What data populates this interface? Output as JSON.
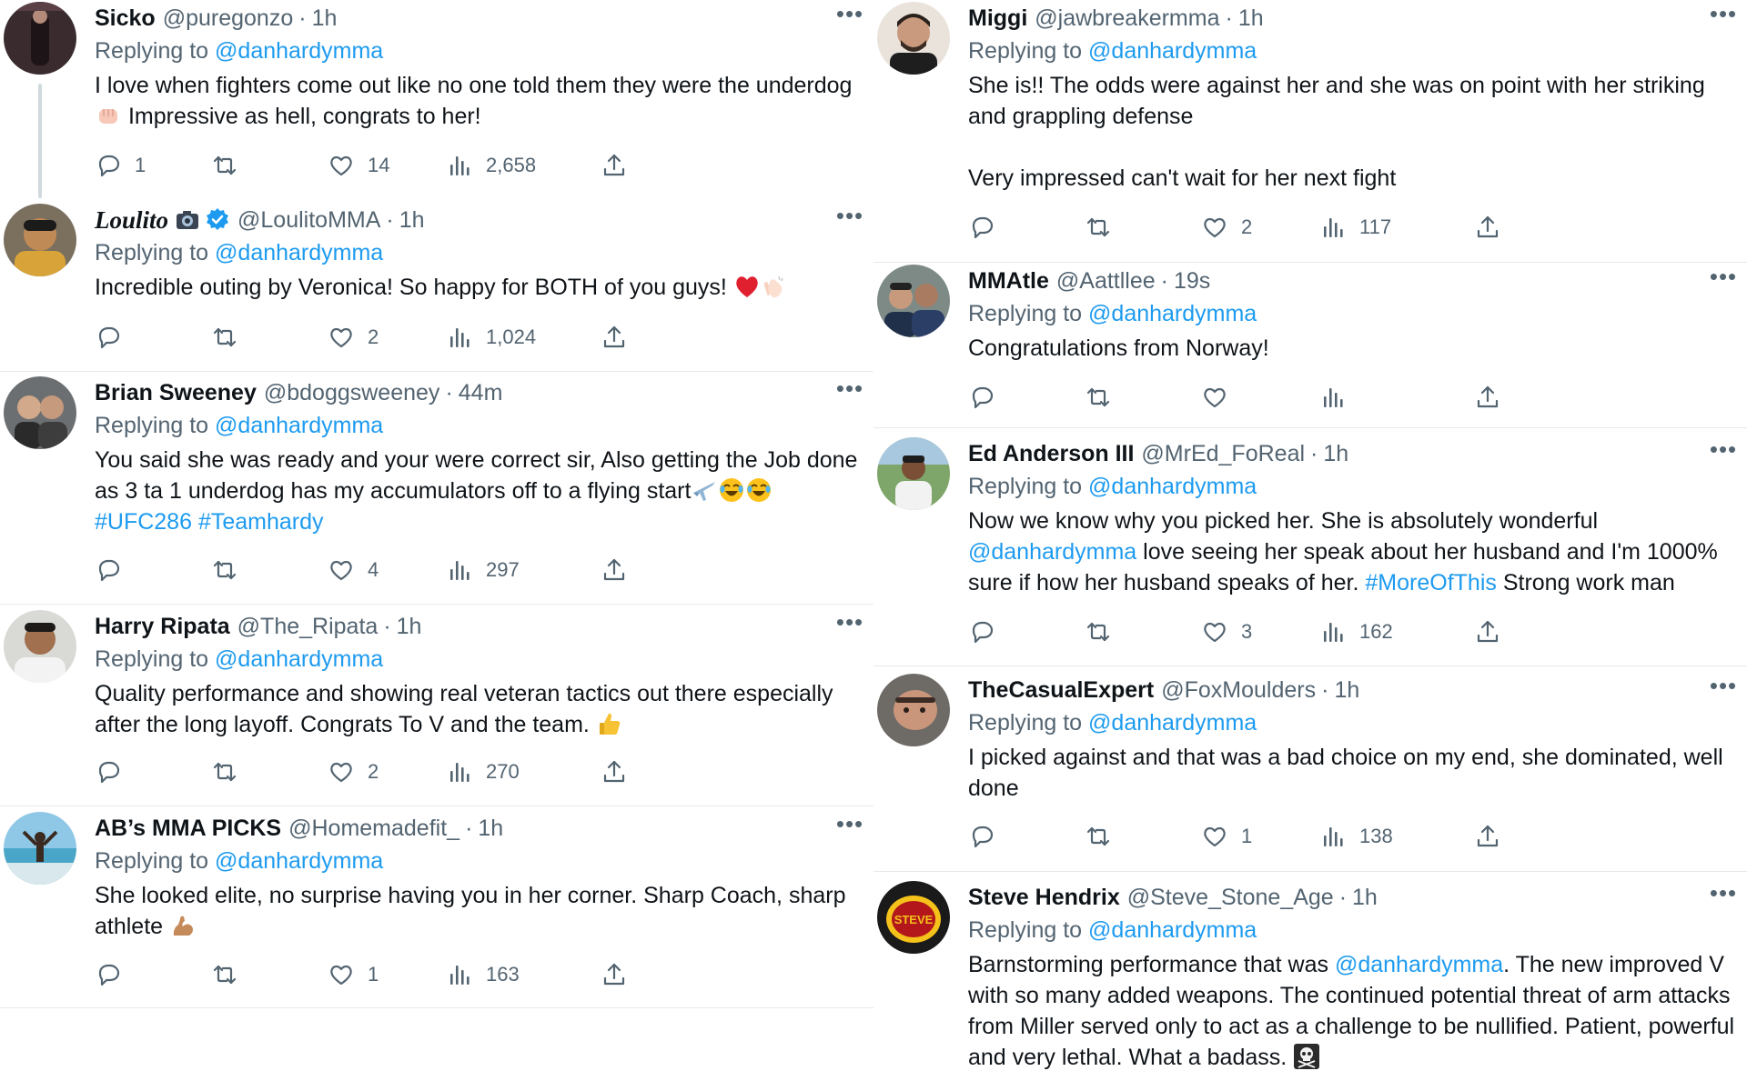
{
  "reply_label": "Replying to",
  "left": [
    {
      "name": "Sicko",
      "handle": "@puregonzo",
      "time": "1h",
      "replying_to": "@danhardymma",
      "text": [
        {
          "t": "I love when fighters come out like no one told them they were the underdog "
        },
        {
          "emoji": "fist-emoji"
        },
        {
          "t": " Impressive as hell, congrats to her!"
        }
      ],
      "stats": {
        "replies": "1",
        "retweets": "",
        "likes": "14",
        "views": "2,658"
      }
    },
    {
      "name": "Loulito",
      "handle": "@LoulitoMMA",
      "time": "1h",
      "replying_to": "@danhardymma",
      "text": [
        {
          "t": "Incredible outing by Veronica! So happy for BOTH of you guys! "
        },
        {
          "emoji": "red-heart-emoji"
        },
        {
          "emoji": "clapping-hands-emoji"
        }
      ],
      "stats": {
        "replies": "",
        "retweets": "",
        "likes": "2",
        "views": "1,024"
      }
    },
    {
      "name": "Brian Sweeney",
      "handle": "@bdoggsweeney",
      "time": "44m",
      "replying_to": "@danhardymma",
      "text": [
        {
          "t": "You said she was ready and your were correct sir, Also getting the Job done as 3 ta 1 underdog has my accumulators off to a flying start"
        },
        {
          "emoji": "airplane-emoji"
        },
        {
          "emoji": "laughing-emoji"
        },
        {
          "emoji": "laughing-emoji"
        },
        {
          "t": " "
        },
        {
          "link": "#UFC286"
        },
        {
          "t": " "
        },
        {
          "link": "#Teamhardy"
        }
      ],
      "stats": {
        "replies": "",
        "retweets": "",
        "likes": "4",
        "views": "297"
      }
    },
    {
      "name": "Harry Ripata",
      "handle": "@The_Ripata",
      "time": "1h",
      "replying_to": "@danhardymma",
      "text": [
        {
          "t": "Quality performance and showing real veteran tactics out there especially after the long layoff. Congrats To V and the team. "
        },
        {
          "emoji": "thumbs-up-emoji"
        }
      ],
      "stats": {
        "replies": "",
        "retweets": "",
        "likes": "2",
        "views": "270"
      }
    },
    {
      "name": "AB’s MMA PICKS",
      "handle": "@Homemadefit_",
      "time": "1h",
      "replying_to": "@danhardymma",
      "text": [
        {
          "t": "She looked elite, no surprise having you in her corner. Sharp Coach, sharp athlete "
        },
        {
          "emoji": "flexed-biceps-emoji"
        }
      ],
      "stats": {
        "replies": "",
        "retweets": "",
        "likes": "1",
        "views": "163"
      }
    }
  ],
  "right": [
    {
      "name": "Miggi",
      "handle": "@jawbreakermma",
      "time": "1h",
      "replying_to": "@danhardymma",
      "text": [
        {
          "t": "She is!! The odds were against her and she was on point with her striking and grappling defense"
        },
        {
          "br": true
        },
        {
          "br": true
        },
        {
          "t": "Very impressed can't wait for her next fight"
        }
      ],
      "stats": {
        "replies": "",
        "retweets": "",
        "likes": "2",
        "views": "117"
      }
    },
    {
      "name": "MMAtle",
      "handle": "@Aattllee",
      "time": "19s",
      "replying_to": "@danhardymma",
      "text": [
        {
          "t": "Congratulations from Norway!"
        }
      ],
      "stats": {
        "replies": "",
        "retweets": "",
        "likes": "",
        "views": ""
      }
    },
    {
      "name": "Ed Anderson III",
      "handle": "@MrEd_FoReal",
      "time": "1h",
      "replying_to": "@danhardymma",
      "text": [
        {
          "t": "Now we know why you picked her. She is absolutely wonderful "
        },
        {
          "link": "@danhardymma"
        },
        {
          "t": " love seeing her speak about her husband and I'm 1000% sure if how her husband speaks of her. "
        },
        {
          "link": "#MoreOfThis"
        },
        {
          "t": " Strong work man"
        }
      ],
      "stats": {
        "replies": "",
        "retweets": "",
        "likes": "3",
        "views": "162"
      }
    },
    {
      "name": "TheCasualExpert",
      "handle": "@FoxMoulders",
      "time": "1h",
      "replying_to": "@danhardymma",
      "text": [
        {
          "t": "I picked against and that was a bad choice on my end, she dominated, well done"
        }
      ],
      "stats": {
        "replies": "",
        "retweets": "",
        "likes": "1",
        "views": "138"
      }
    },
    {
      "name": "Steve Hendrix",
      "handle": "@Steve_Stone_Age",
      "time": "1h",
      "replying_to": "@danhardymma",
      "text": [
        {
          "t": "Barnstorming performance that was "
        },
        {
          "link": "@danhardymma"
        },
        {
          "t": ". The new improved V with so many added weapons. The continued potential threat of arm attacks from Miller served only to act as a challenge to be nullified. Patient, powerful and very lethal. What a badass. "
        },
        {
          "emoji": "skull-crossbones-emoji"
        }
      ],
      "stats": {
        "replies": "",
        "retweets": "",
        "likes": "",
        "views": ""
      },
      "avatar_text": "STEVE"
    }
  ],
  "colors": {
    "mention": "#1d9bf0",
    "muted": "#536471",
    "text": "#0f1419",
    "verified": "#1d9bf0",
    "heart": "#e0245e"
  }
}
